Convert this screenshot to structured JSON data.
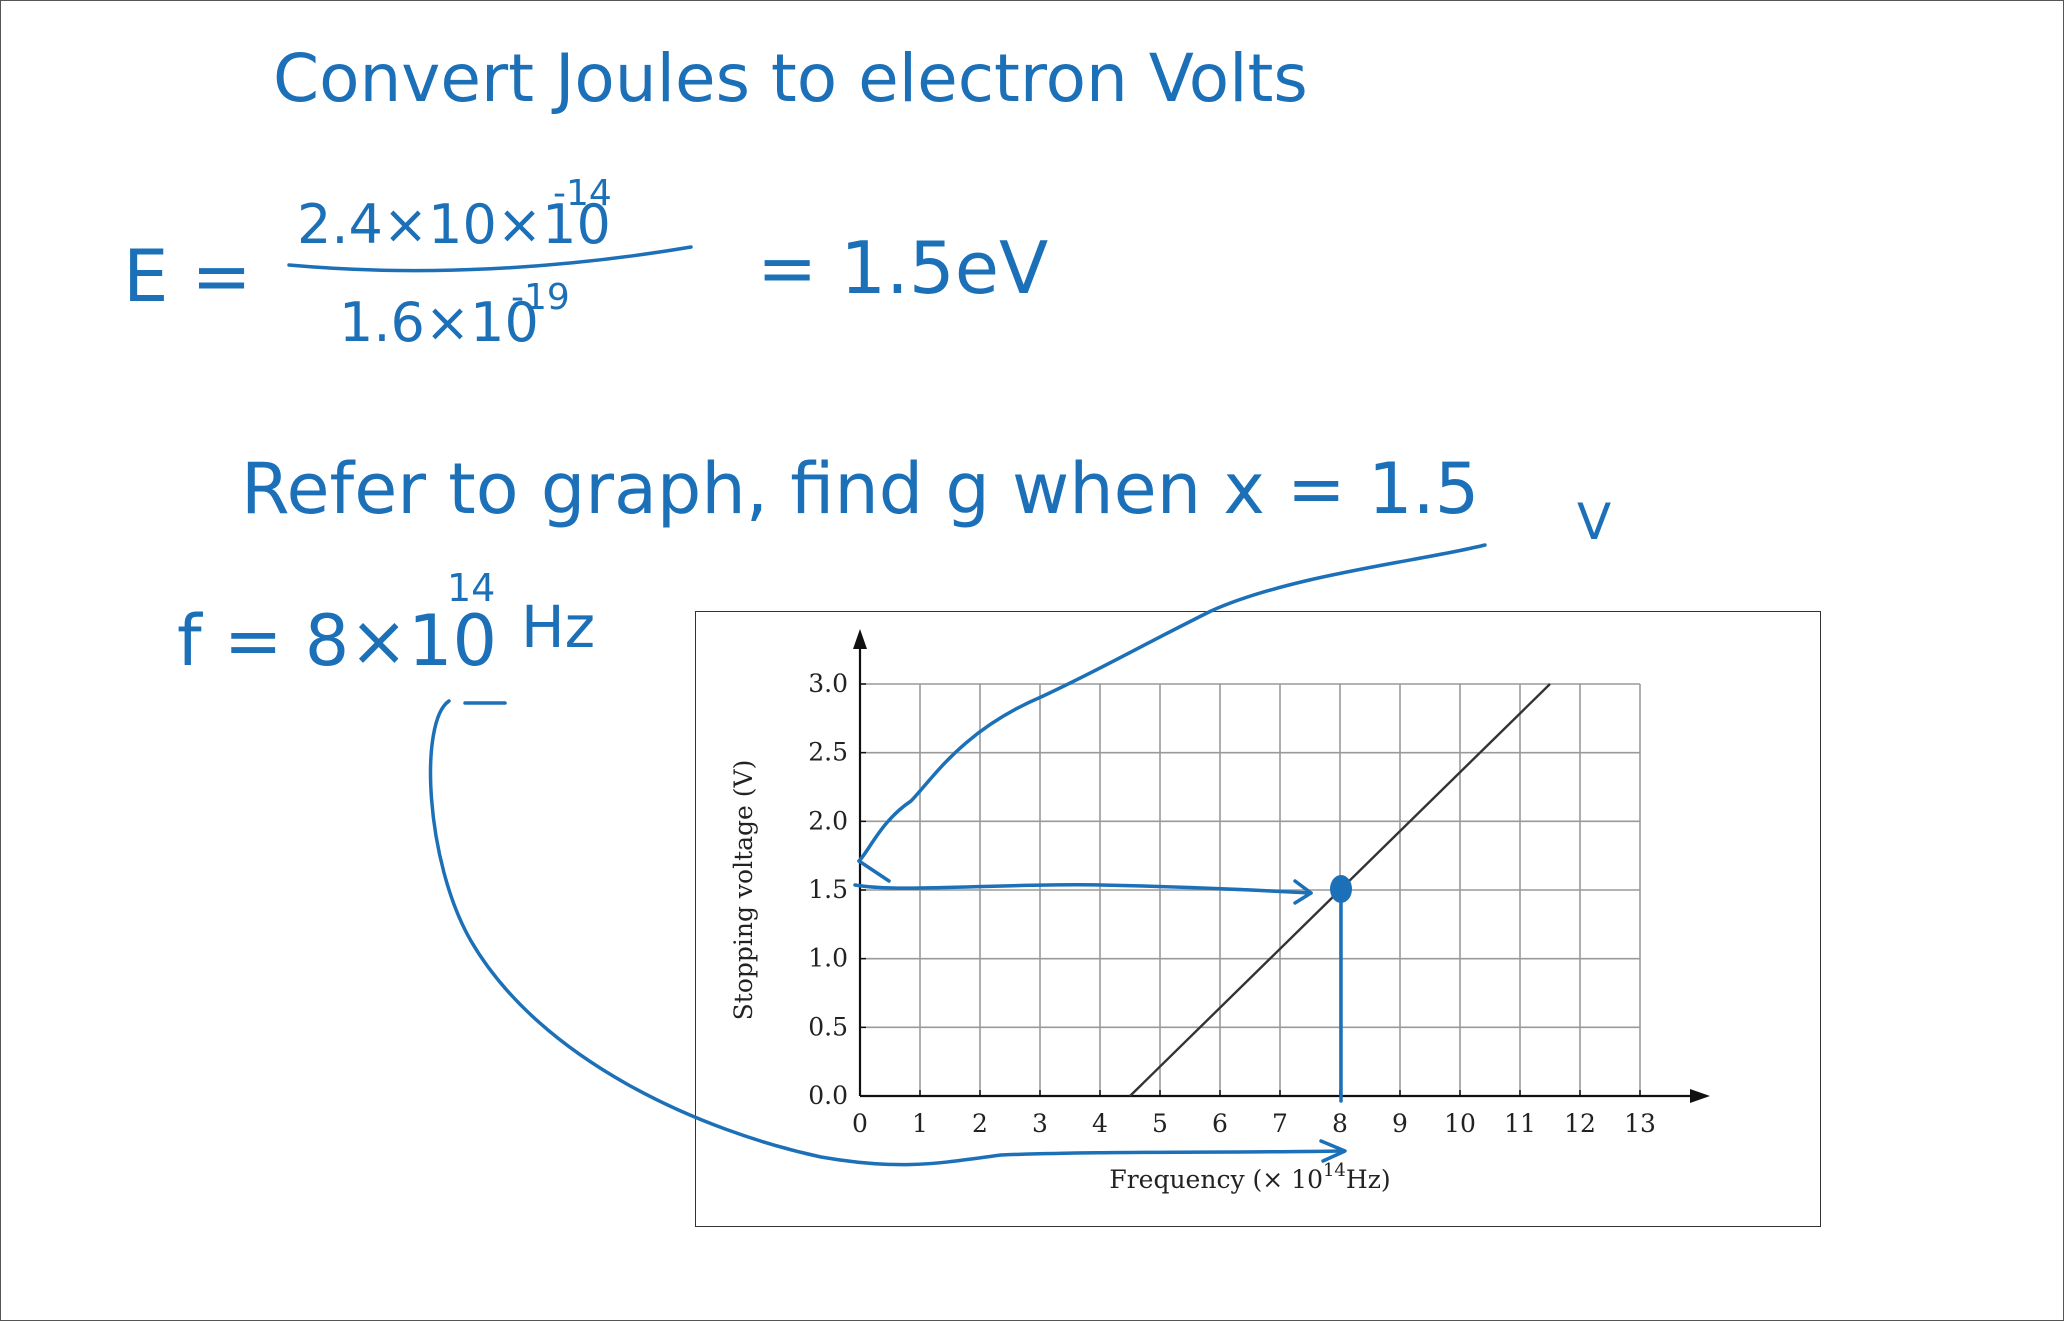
{
  "notes": {
    "heading": "Convert Joules to electron Volts",
    "energy_lhs": "E =",
    "energy_numerator": "2.4×10×10",
    "energy_numerator_exp": "-14",
    "energy_denominator": "1.6×10",
    "energy_denominator_exp": "-19",
    "energy_result": "= 1.5eV",
    "instruction": "Refer to graph, find g when x = 1.5",
    "instruction_unit": "V",
    "answer": "f = 8×10",
    "answer_exp": "14",
    "answer_unit": "Hz"
  },
  "ink_color": "#1c70b8",
  "chart_data": {
    "type": "line",
    "xlabel": "Frequency (× 10",
    "xlabel_exp": "14",
    "xlabel_unit": "Hz)",
    "ylabel": "Stopping voltage (V)",
    "x_ticks": [
      "0",
      "1",
      "2",
      "3",
      "4",
      "5",
      "6",
      "7",
      "8",
      "9",
      "10",
      "11",
      "12",
      "13"
    ],
    "y_ticks": [
      "0.0",
      "0.5",
      "1.0",
      "1.5",
      "2.0",
      "2.5",
      "3.0"
    ],
    "xlim": [
      0,
      13
    ],
    "ylim": [
      0,
      3
    ],
    "grid": true,
    "series": [
      {
        "x": [
          4.5,
          11.5
        ],
        "y": [
          0.0,
          3.0
        ],
        "color": "#333333"
      }
    ],
    "annotation": {
      "x": 8,
      "y": 1.5,
      "color": "#1c70b8"
    }
  }
}
